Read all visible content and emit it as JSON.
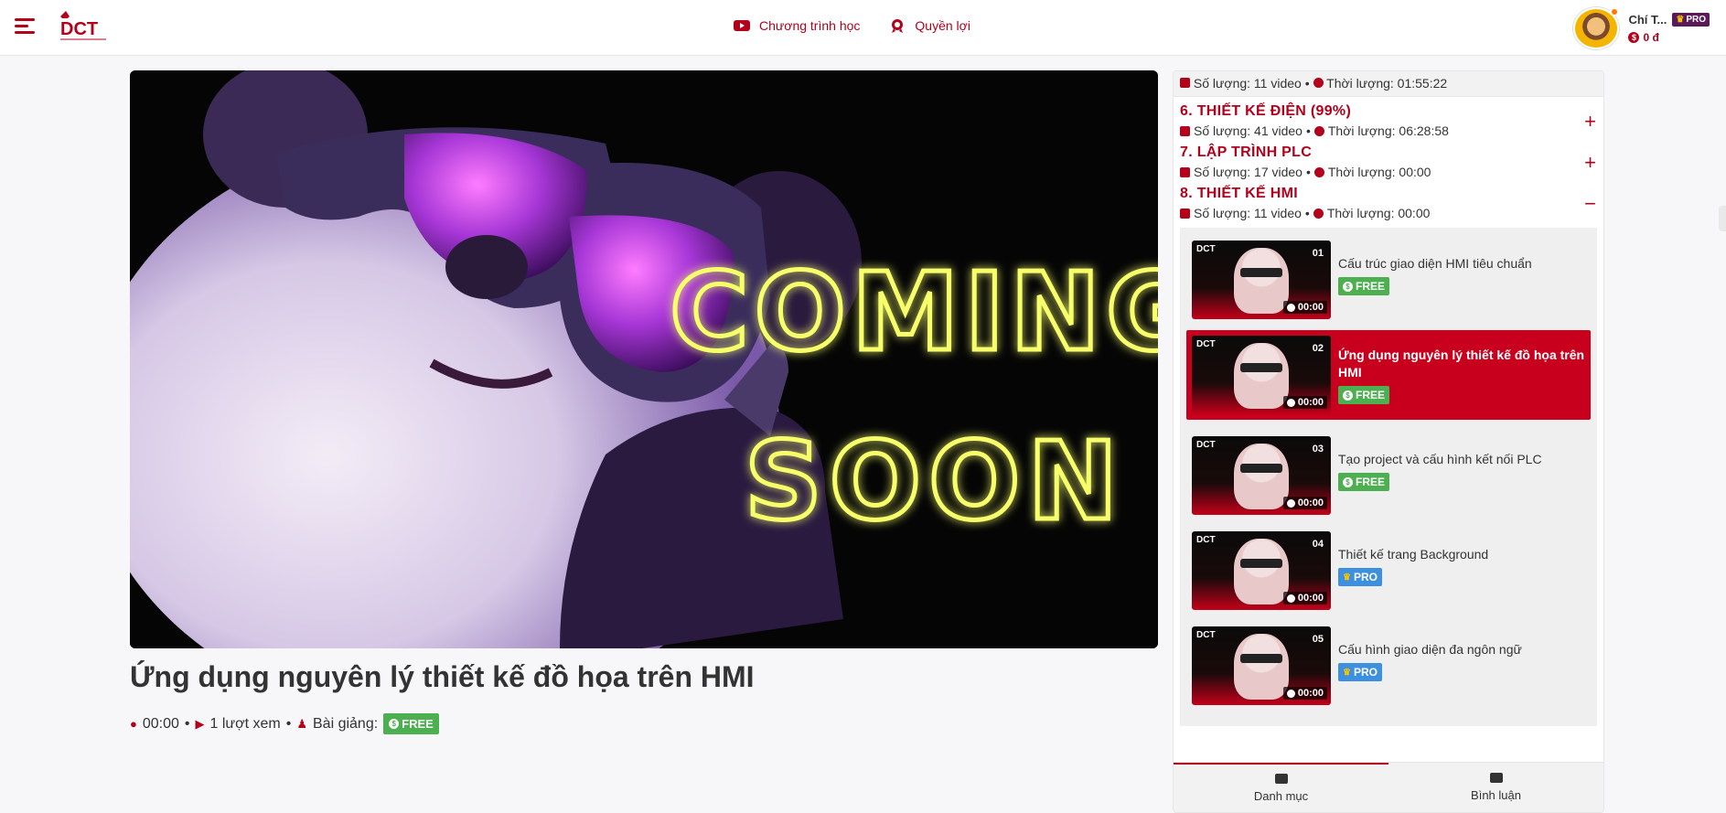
{
  "header": {
    "nav": [
      {
        "label": "Chương trình học",
        "icon": "youtube-icon"
      },
      {
        "label": "Quyền lợi",
        "icon": "award-icon"
      }
    ],
    "user": {
      "name": "Chí T...",
      "badge": "PRO",
      "balance": "0 đ"
    }
  },
  "video": {
    "poster_line1": "COMING",
    "poster_line2": "SOON",
    "title": "Ứng dụng nguyên lý thiết kế đồ họa trên HMI",
    "duration": "00:00",
    "views": "1 lượt xem",
    "lesson_label": "Bài giảng:",
    "badge": "FREE"
  },
  "sidebar": {
    "top_meta": {
      "count": "Số lượng: 11 video",
      "duration": "Thời lượng: 01:55:22"
    },
    "sections": [
      {
        "title": "6. THIẾT KẾ ĐIỆN (99%)",
        "count": "Số lượng: 41 video",
        "duration": "Thời lượng: 06:28:58",
        "toggle": "+"
      },
      {
        "title": "7. LẬP TRÌNH PLC",
        "count": "Số lượng: 17 video",
        "duration": "Thời lượng: 00:00",
        "toggle": "+"
      },
      {
        "title": "8. THIẾT KẾ HMI",
        "count": "Số lượng: 11 video",
        "duration": "Thời lượng: 00:00",
        "toggle": "−"
      }
    ],
    "lessons": [
      {
        "num": "01",
        "title": "Cấu trúc giao diện HMI tiêu chuẩn",
        "duration": "00:00",
        "badge": "FREE",
        "active": false
      },
      {
        "num": "02",
        "title": "Ứng dụng nguyên lý thiết kế đồ họa trên HMI",
        "duration": "00:00",
        "badge": "FREE",
        "active": true
      },
      {
        "num": "03",
        "title": "Tạo project và cấu hình kết nối PLC",
        "duration": "00:00",
        "badge": "FREE",
        "active": false
      },
      {
        "num": "04",
        "title": "Thiết kế trang Background",
        "duration": "00:00",
        "badge": "PRO",
        "active": false
      },
      {
        "num": "05",
        "title": "Cấu hình giao diện đa ngôn ngữ",
        "duration": "00:00",
        "badge": "PRO",
        "active": false
      }
    ],
    "tabs": [
      {
        "label": "Danh mục",
        "active": true
      },
      {
        "label": "Bình luận",
        "active": false
      }
    ]
  },
  "colors": {
    "brand": "#b3001b",
    "active_row": "#c8001e",
    "free": "#4caf50",
    "pro": "#3d8fe0",
    "neon": "#f7ff6a"
  }
}
